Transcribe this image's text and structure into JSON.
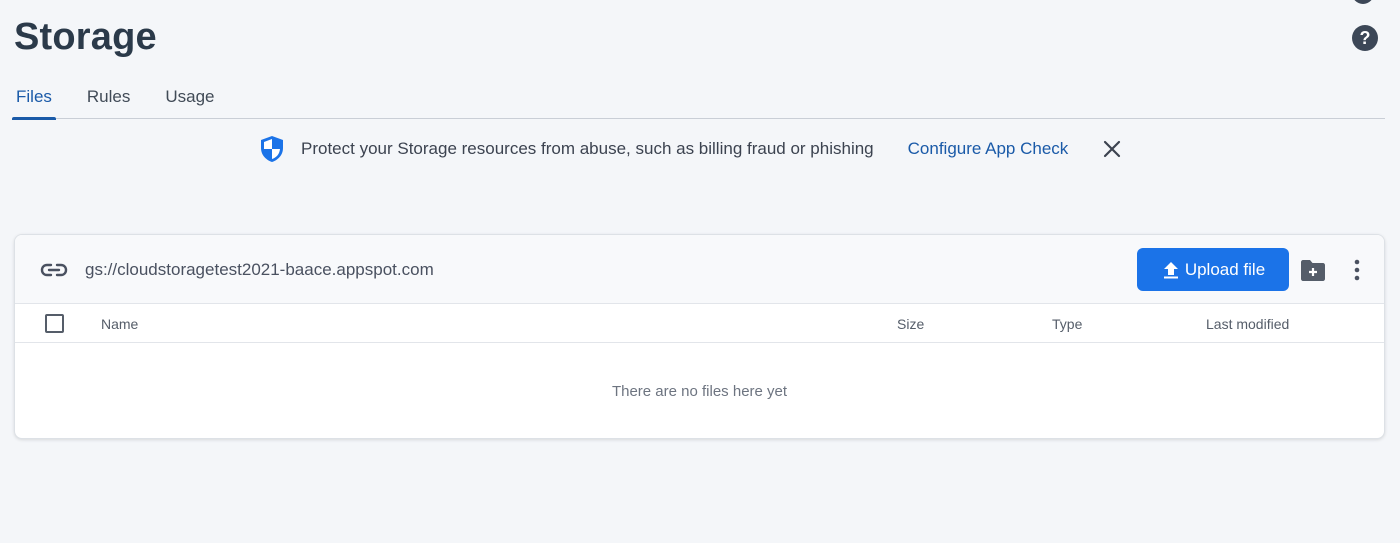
{
  "page": {
    "title": "Storage"
  },
  "tabs": [
    {
      "label": "Files",
      "active": true
    },
    {
      "label": "Rules",
      "active": false
    },
    {
      "label": "Usage",
      "active": false
    }
  ],
  "banner": {
    "text": "Protect your Storage resources from abuse, such as billing fraud or phishing",
    "link": "Configure App Check",
    "icon": "shield-icon"
  },
  "bucket": {
    "path": "gs://cloudstoragetest2021-baace.appspot.com",
    "upload_label": "Upload file"
  },
  "table": {
    "columns": [
      "Name",
      "Size",
      "Type",
      "Last modified"
    ],
    "empty_message": "There are no files here yet"
  },
  "colors": {
    "accent": "#1a5aa8",
    "button": "#1b73e8",
    "background": "#f4f6f9"
  }
}
